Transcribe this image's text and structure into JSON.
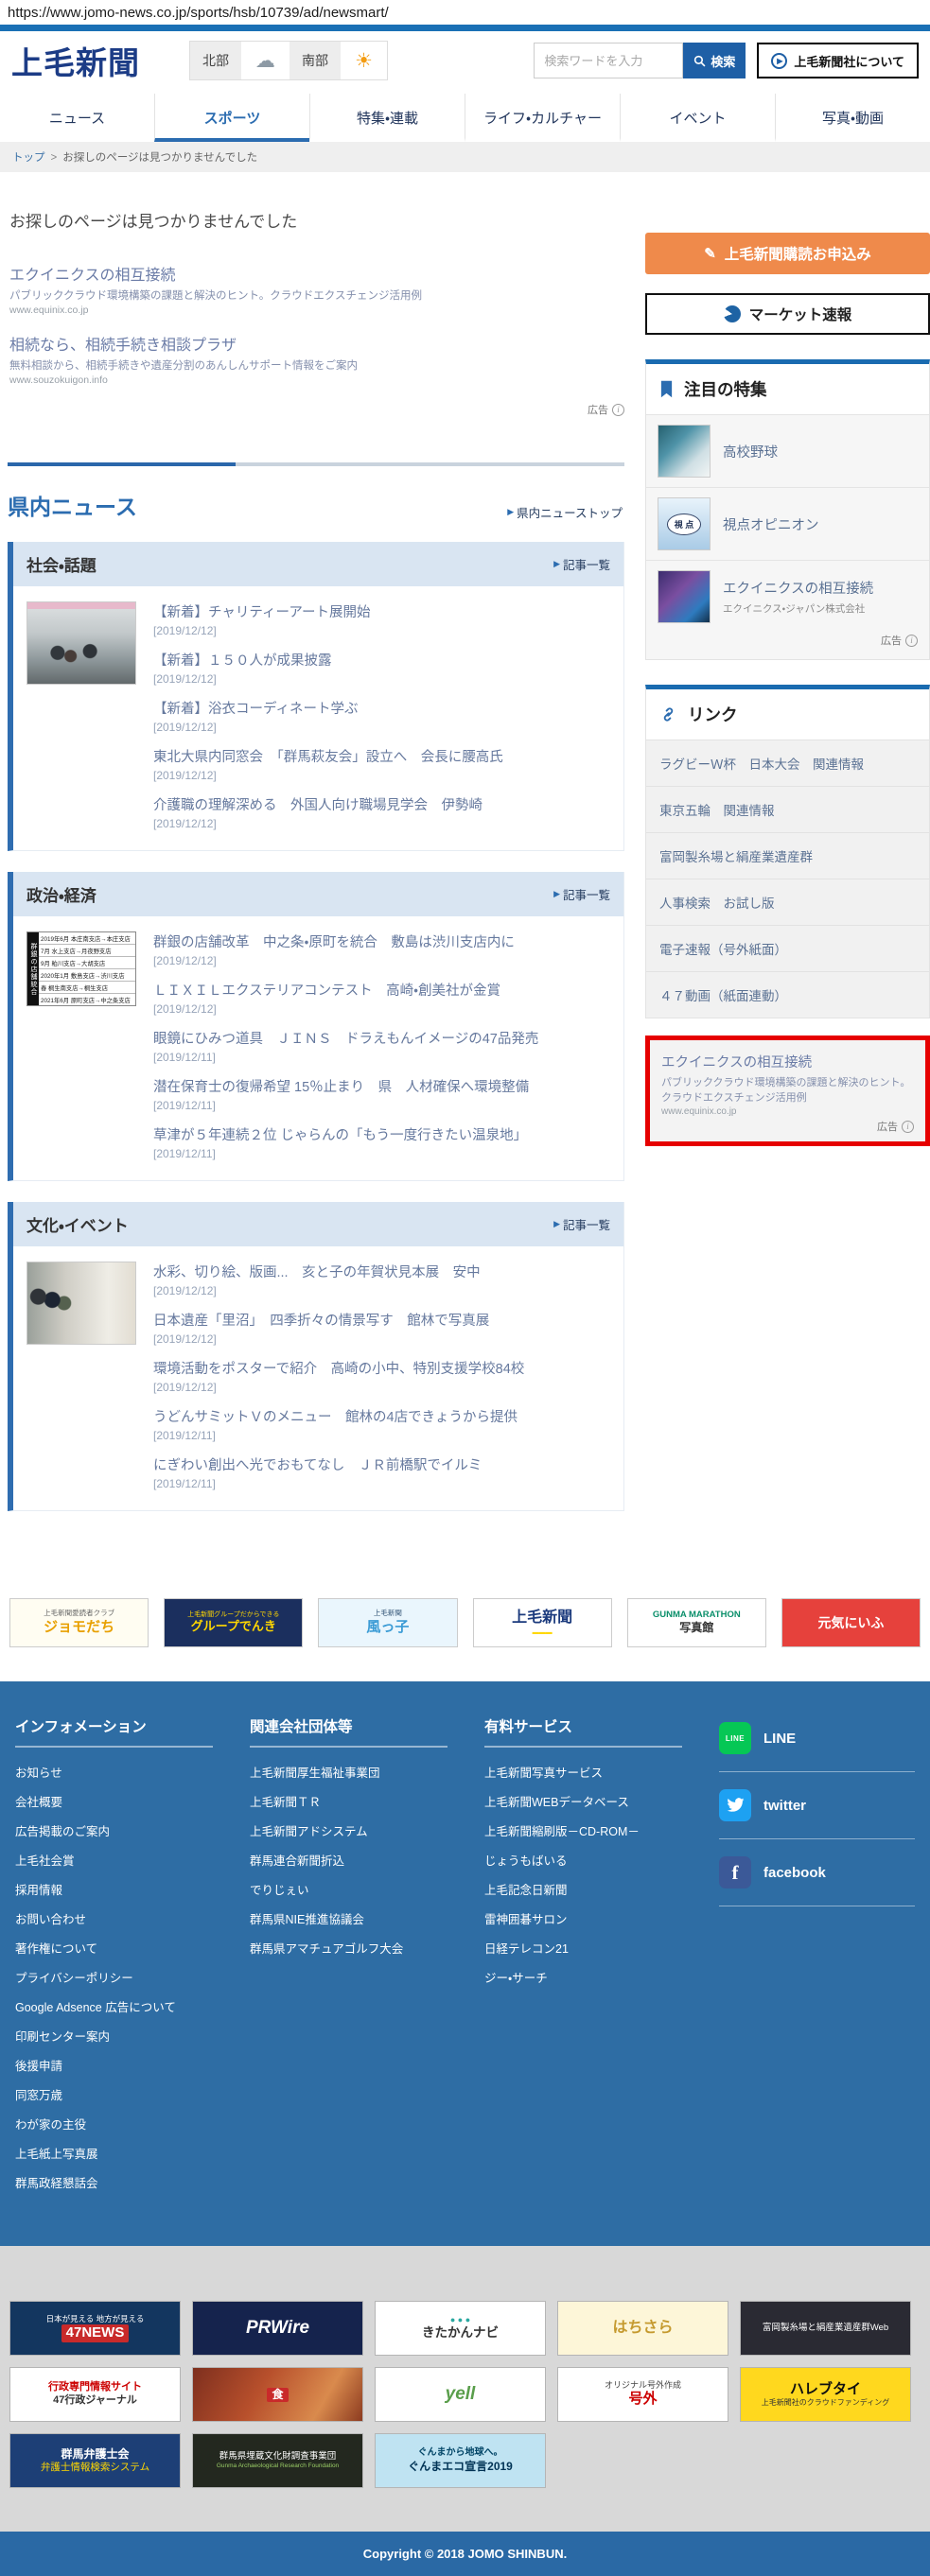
{
  "browser": {
    "url": "https://www.jomo-news.co.jp/sports/hsb/10739/ad/newsmart/"
  },
  "header": {
    "logo": "上毛新聞",
    "weather": {
      "north_label": "北部",
      "south_label": "南部",
      "north_icon": "cloud",
      "south_icon": "sun"
    },
    "search": {
      "placeholder": "検索ワードを入力",
      "button_label": "検索"
    },
    "about_button": "上毛新聞社について"
  },
  "nav": {
    "tabs": [
      {
        "key": "news",
        "label": "ニュース",
        "active": false
      },
      {
        "key": "sports",
        "label": "スポーツ",
        "active": true
      },
      {
        "key": "feature",
        "label": "特集・連載",
        "active": false
      },
      {
        "key": "life-culture",
        "label": "ライフ・カルチャー",
        "active": false
      },
      {
        "key": "event",
        "label": "イベント",
        "active": false
      },
      {
        "key": "photo-video",
        "label": "写真・動画",
        "active": false
      }
    ]
  },
  "breadcrumb": {
    "home": "トップ",
    "separator": ">",
    "current": "お探しのページは見つかりませんでした"
  },
  "main": {
    "page_title": "お探しのページは見つかりませんでした",
    "ads_label": "広告",
    "ads": [
      {
        "title": "エクイニクスの相互接続",
        "description": "パブリッククラウド環境構築の課題と解決のヒント。クラウドエクスチェンジ活用例",
        "url": "www.equinix.co.jp"
      },
      {
        "title": "相続なら、相続手続き相談プラザ",
        "description": "無料相談から、相続手続きや遺産分割のあんしんサポート情報をご案内",
        "url": "www.souzokuigon.info"
      }
    ],
    "kennai": {
      "title": "県内ニュース",
      "top_link": "県内ニューストップ",
      "sections": [
        {
          "title": "社会・話題",
          "more": "記事一覧",
          "items": [
            {
              "title": "【新着】チャリティーアート展開始",
              "date": "[2019/12/12]"
            },
            {
              "title": "【新着】１５０人が成果披露",
              "date": "[2019/12/12]"
            },
            {
              "title": "【新着】浴衣コーディネート学ぶ",
              "date": "[2019/12/12]"
            },
            {
              "title": "東北大県内同窓会　「群馬萩友会」設立へ　会長に腰高氏",
              "date": "[2019/12/12]"
            },
            {
              "title": "介護職の理解深める　外国人向け職場見学会　伊勢崎",
              "date": "[2019/12/12]"
            }
          ]
        },
        {
          "title": "政治・経済",
          "more": "記事一覧",
          "thumb_table": {
            "title": "群銀の店舗統合",
            "rows": [
              "2019年6月 本庄南支店→本庄支店",
              "7月 水上支店→月夜野支店",
              "9月 粕川支店→大胡支店",
              "2020年1月 敷島支店→渋川支店",
              "春 桐生南支店→桐生支店",
              "2021年6月 原町支店→中之条支店"
            ]
          },
          "items": [
            {
              "title": "群銀の店舗改革　中之条・原町を統合　敷島は渋川支店内に",
              "date": "[2019/12/12]"
            },
            {
              "title": "ＬＩＸＩＬエクステリアコンテスト　高崎・創美社が金賞",
              "date": "[2019/12/12]"
            },
            {
              "title": "眼鏡にひみつ道具　ＪＩＮＳ　ドラえもんイメージの47品発売",
              "date": "[2019/12/11]"
            },
            {
              "title": "潜在保育士の復帰希望 15％止まり　県　人材確保へ環境整備",
              "date": "[2019/12/11]"
            },
            {
              "title": "草津が５年連続２位 じゃらんの「もう一度行きたい温泉地」",
              "date": "[2019/12/11]"
            }
          ]
        },
        {
          "title": "文化・イベント",
          "more": "記事一覧",
          "items": [
            {
              "title": "水彩、切り絵、版画...　亥と子の年賀状見本展　安中",
              "date": "[2019/12/12]"
            },
            {
              "title": "日本遺産「里沼」　四季折々の情景写す　館林で写真展",
              "date": "[2019/12/12]"
            },
            {
              "title": "環境活動をポスターで紹介　高崎の小中、特別支援学校84校",
              "date": "[2019/12/12]"
            },
            {
              "title": "うどんサミットＶのメニュー　館林の4店できょうから提供",
              "date": "[2019/12/11]"
            },
            {
              "title": "にぎわい創出へ光でおもてなし　ＪＲ前橋駅でイルミ",
              "date": "[2019/12/11]"
            }
          ]
        }
      ]
    }
  },
  "sidebar": {
    "subscribe_button": "上毛新聞購読お申込み",
    "market_button": "マーケット速報",
    "featured": {
      "title": "注目の特集",
      "ad_label": "広告",
      "items": [
        {
          "label": "高校野球",
          "thumb": "baseball"
        },
        {
          "label": "視点オピニオン",
          "thumb": "shiten",
          "thumb_text": "視 点"
        },
        {
          "label": "エクイニクスの相互接続",
          "sub": "エクイニクス・ジャパン株式会社",
          "thumb": "equinix"
        }
      ]
    },
    "links": {
      "title": "リンク",
      "items": [
        "ラグビーＷ杯　日本大会　関連情報",
        "東京五輪　関連情報",
        "富岡製糸場と絹産業遺産群",
        "人事検索　お試し版",
        "電子速報（号外紙面）",
        "４７動画（紙面連動）"
      ]
    },
    "red_ad": {
      "title": "エクイニクスの相互接続",
      "description": "パブリッククラウド環境構築の課題と解決のヒント。クラウドエクスチェンジ活用例",
      "url": "www.equinix.co.jp",
      "label": "広告"
    }
  },
  "partners": [
    {
      "id": "jomodachi",
      "bg": "#fffdf2",
      "lines": [
        {
          "text": "上毛新聞愛読者クラブ",
          "size": 7.5,
          "color": "#666"
        },
        {
          "text": "ジョモだち",
          "size": 15,
          "color": "#e8a000",
          "bold": true
        }
      ]
    },
    {
      "id": "group-denki",
      "bg": "#1b2f5e",
      "lines": [
        {
          "text": "上毛新聞グループだからできる",
          "size": 7,
          "color": "#ffd700"
        },
        {
          "text": "グループでんき",
          "size": 13,
          "color": "#ffd700",
          "bold": true
        }
      ]
    },
    {
      "id": "kazekko",
      "bg": "#eaf6fd",
      "lines": [
        {
          "text": "上毛新聞",
          "size": 7.5,
          "color": "#357"
        },
        {
          "text": "風っ子",
          "size": 15,
          "color": "#3a9bd5",
          "bold": true
        }
      ]
    },
    {
      "id": "jomo-shinbunsha",
      "bg": "#ffffff",
      "lines": [
        {
          "text": "上毛新聞",
          "size": 16,
          "color": "#1b3a7d",
          "bold": true
        },
        {
          "text": "▬▬▬",
          "size": 7,
          "color": "#ffd700"
        }
      ]
    },
    {
      "id": "gunma-marathon",
      "bg": "#ffffff",
      "lines": [
        {
          "text": "GUNMA MARATHON",
          "size": 9.5,
          "color": "#0a8f6a",
          "bold": true
        },
        {
          "text": "写真館",
          "size": 12,
          "color": "#333",
          "bold": true
        }
      ]
    },
    {
      "id": "genki",
      "bg": "#e6413c",
      "lines": [
        {
          "text": "元気にいふ",
          "size": 14,
          "color": "#fff",
          "bold": true
        }
      ]
    }
  ],
  "footer": {
    "columns": [
      {
        "title": "インフォメーション",
        "links": [
          "お知らせ",
          "会社概要",
          "広告掲載のご案内",
          "上毛社会賞",
          "採用情報",
          "お問い合わせ",
          "著作権について",
          "プライバシーポリシー",
          "Google Adsence 広告について",
          "印刷センター案内",
          "後援申請",
          "同窓万歳",
          "わが家の主役",
          "上毛紙上写真展",
          "群馬政経懇話会"
        ]
      },
      {
        "title": "関連会社団体等",
        "links": [
          "上毛新聞厚生福祉事業団",
          "上毛新聞ＴＲ",
          "上毛新聞アドシステム",
          "群馬連合新聞折込",
          "でりじぇい",
          "群馬県NIE推進協議会",
          "群馬県アマチュアゴルフ大会"
        ]
      },
      {
        "title": "有料サービス",
        "links": [
          "上毛新聞写真サービス",
          "上毛新聞WEBデータベース",
          "上毛新聞縮刷版－CD-ROM－",
          "じょうもばいる",
          "上毛記念日新聞",
          "雷神囲碁サロン",
          "日経テレコン21",
          "ジー・サーチ"
        ]
      }
    ],
    "sns": [
      {
        "key": "line",
        "label": "LINE",
        "icon_text": "LINE"
      },
      {
        "key": "twitter",
        "label": "twitter",
        "icon_text": ""
      },
      {
        "key": "facebook",
        "label": "facebook",
        "icon_text": "f"
      }
    ]
  },
  "bottom_ads": {
    "rows": [
      [
        {
          "id": "47news",
          "bg": "#13365f",
          "lines": [
            {
              "text": "日本が見える 地方が見える",
              "size": 8.5,
              "color": "#fff"
            },
            {
              "text": "47NEWS",
              "size": 15,
              "color": "#fff",
              "bold": true,
              "chip": "#c92a2a"
            }
          ]
        },
        {
          "id": "prwire",
          "bg": "#15234d",
          "lines": [
            {
              "text": "PRWire",
              "size": 19,
              "color": "#fff",
              "bold": true,
              "italic": true
            }
          ]
        },
        {
          "id": "kitakan-navi",
          "bg": "#ffffff",
          "lines": [
            {
              "text": "● ● ●",
              "size": 9,
              "color": "#2aa8a0"
            },
            {
              "text": "きたかんナビ",
              "size": 13.5,
              "color": "#333",
              "bold": true
            }
          ]
        },
        {
          "id": "hachisara",
          "bg": "#fdf6d8",
          "lines": [
            {
              "text": "はちさら",
              "size": 16,
              "color": "#c59a2f",
              "bold": true
            }
          ]
        },
        {
          "id": "tomioka-web",
          "bg": "#2a2a33",
          "lines": [
            {
              "text": "富岡製糸場と絹産業遺産群Web",
              "size": 9.5,
              "color": "#fff"
            }
          ]
        }
      ],
      [
        {
          "id": "gyosei-journal",
          "bg": "#ffffff",
          "lines": [
            {
              "text": "行政専門情報サイト",
              "size": 11,
              "color": "#c00",
              "bold": true
            },
            {
              "text": "47行政ジャーナル",
              "size": 11,
              "color": "#333",
              "bold": true
            }
          ]
        },
        {
          "id": "food-photo",
          "bg": "linear-gradient(120deg,#7e2f1e 0%,#b8502c 40%,#d98a4d 75%,#8c3b20 100%)",
          "lines": [
            {
              "text": "食",
              "size": 12,
              "color": "#fff",
              "bold": true,
              "chip": "#c92a2a"
            }
          ]
        },
        {
          "id": "yell",
          "bg": "#ffffff",
          "lines": [
            {
              "text": "yell",
              "size": 19,
              "color": "#5a9e4b",
              "bold": true,
              "italic": true
            }
          ]
        },
        {
          "id": "gogai",
          "bg": "#ffffff",
          "lines": [
            {
              "text": "オリジナル号外作成",
              "size": 9,
              "color": "#444"
            },
            {
              "text": "号外",
              "size": 15,
              "color": "#c00",
              "bold": true
            }
          ]
        },
        {
          "id": "harebutai",
          "bg": "#ffd81e",
          "lines": [
            {
              "text": "ハレブタイ",
              "size": 15,
              "color": "#111",
              "bold": true
            },
            {
              "text": "上毛新聞社のクラウドファンディング",
              "size": 8,
              "color": "#333"
            }
          ]
        }
      ],
      [
        {
          "id": "gunma-bengoshi",
          "bg": "#1d3f76",
          "lines": [
            {
              "text": "群馬弁護士会",
              "size": 12,
              "color": "#fff",
              "bold": true
            },
            {
              "text": "弁護士情報検索システム",
              "size": 10.5,
              "color": "#ffd700"
            }
          ]
        },
        {
          "id": "gunma-maibun",
          "bg": "#23281f",
          "lines": [
            {
              "text": "群馬県埋蔵文化財調査事業団",
              "size": 9.5,
              "color": "#fff"
            },
            {
              "text": "Gunma Archaeological Research Foundation",
              "size": 6.5,
              "color": "#9c6"
            }
          ]
        },
        {
          "id": "gunma-eco",
          "bg": "#bfe3f2",
          "lines": [
            {
              "text": "ぐんまから地球へ。",
              "size": 10,
              "color": "#046",
              "bold": true
            },
            {
              "text": "ぐんまエコ宣言2019",
              "size": 12,
              "color": "#035",
              "bold": true
            }
          ]
        }
      ]
    ]
  },
  "copyright": "Copyright © 2018 JOMO SHINBUN."
}
